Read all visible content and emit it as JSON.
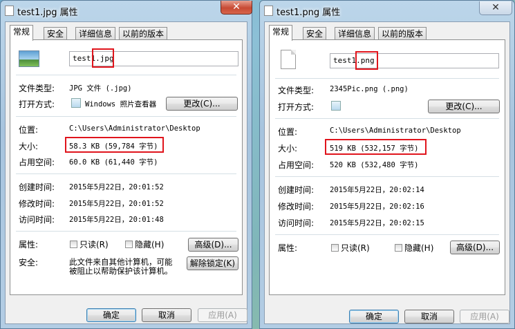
{
  "left": {
    "title": "test1.jpg 属性",
    "close": "✕",
    "tabs": [
      "常规",
      "安全",
      "详细信息",
      "以前的版本"
    ],
    "filename_base": "test1.",
    "filename_ext": "jpg",
    "labels": {
      "type": "文件类型:",
      "open_with": "打开方式:",
      "location": "位置:",
      "size": "大小:",
      "size_on_disk": "占用空间:",
      "created": "创建时间:",
      "modified": "修改时间:",
      "accessed": "访问时间:",
      "attributes": "属性:",
      "security": "安全:"
    },
    "type_value": "JPG 文件 (.jpg)",
    "open_with_value": "Windows 照片查看器",
    "change_button": "更改(C)...",
    "location_value": "C:\\Users\\Administrator\\Desktop",
    "size_value": "58.3 KB (59,784 字节)",
    "size_on_disk_value": "60.0 KB (61,440 字节)",
    "created_value": "2015年5月22日，20:01:52",
    "modified_value": "2015年5月22日，20:01:52",
    "accessed_value": "2015年5月22日，20:01:48",
    "readonly_label": "只读(R)",
    "hidden_label": "隐藏(H)",
    "advanced_button": "高级(D)...",
    "security_text_1": "此文件来自其他计算机，可能",
    "security_text_2": "被阻止以帮助保护该计算机。",
    "unblock_button": "解除锁定(K)",
    "ok_button": "确定",
    "cancel_button": "取消",
    "apply_button": "应用(A)"
  },
  "right": {
    "title": "test1.png 属性",
    "close": "✕",
    "tabs": [
      "常规",
      "安全",
      "详细信息",
      "以前的版本"
    ],
    "filename_base": "test1.",
    "filename_ext": "png",
    "labels": {
      "type": "文件类型:",
      "open_with": "打开方式:",
      "location": "位置:",
      "size": "大小:",
      "size_on_disk": "占用空间:",
      "created": "创建时间:",
      "modified": "修改时间:",
      "accessed": "访问时间:",
      "attributes": "属性:"
    },
    "type_value": "2345Pic.png (.png)",
    "change_button": "更改(C)...",
    "location_value": "C:\\Users\\Administrator\\Desktop",
    "size_value": "519 KB (532,157 字节)",
    "size_on_disk_value": "520 KB (532,480 字节)",
    "created_value": "2015年5月22日，20:02:14",
    "modified_value": "2015年5月22日，20:02:16",
    "accessed_value": "2015年5月22日，20:02:15",
    "readonly_label": "只读(R)",
    "hidden_label": "隐藏(H)",
    "advanced_button": "高级(D)...",
    "ok_button": "确定",
    "cancel_button": "取消",
    "apply_button": "应用(A)"
  },
  "colors": {
    "highlight": "#e0141c"
  }
}
